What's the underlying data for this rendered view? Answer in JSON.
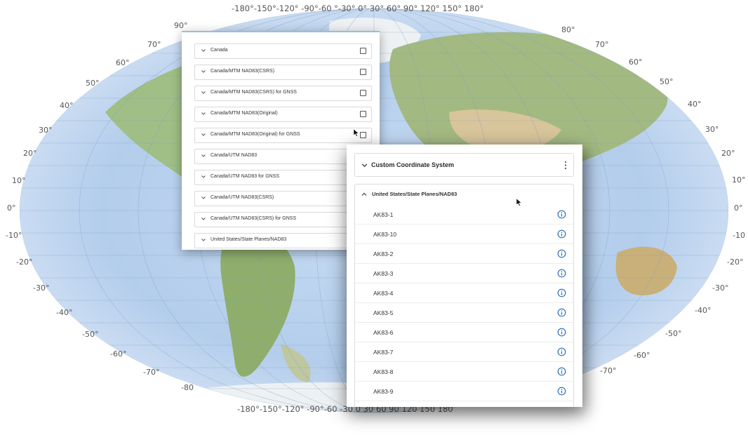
{
  "map": {
    "lat_labels_left": [
      "90°",
      "70°",
      "60°",
      "50°",
      "40°",
      "30°",
      "20°",
      "10°",
      "0°",
      "-10°",
      "-20°",
      "-30°",
      "-40°",
      "-50°",
      "-60°",
      "-70°",
      "-80"
    ],
    "lat_labels_right": [
      "80°",
      "70°",
      "60°",
      "50°",
      "40°",
      "30°",
      "20°",
      "10°",
      "0°",
      "-10",
      "-20°",
      "-30°",
      "-40°",
      "-50°",
      "-60°",
      "-70°"
    ],
    "lon_labels_top": "-180°-150°-120° -90°-60 °-30° 0° 30° 60° 90° 120° 150° 180°",
    "lon_labels_bottom": "-180°-150°-120° -90°-60 -30 0 30 60 90 120 150 180",
    "colors": {
      "ocean": "#b9d3ef",
      "land_green": "#8fb37a",
      "land_tan": "#d9c49a",
      "ice": "#f2f4f6"
    }
  },
  "coordinate_list": {
    "items": [
      {
        "label": "Canada",
        "checkbox": true
      },
      {
        "label": "Canada/MTM NAD83(CSRS)",
        "checkbox": true
      },
      {
        "label": "Canada/MTM NAD83(CSRS) for GNSS",
        "checkbox": true
      },
      {
        "label": "Canada/MTM NAD83(Original)",
        "checkbox": true
      },
      {
        "label": "Canada/MTM NAD83(Original) for GNSS",
        "checkbox": true
      },
      {
        "label": "Canada/UTM NAD83",
        "checkbox": false
      },
      {
        "label": "Canada/UTM NAD83 for GNSS",
        "checkbox": false
      },
      {
        "label": "Canada/UTM NAD83(CSRS)",
        "checkbox": false
      },
      {
        "label": "Canada/UTM NAD83(CSRS) for GNSS",
        "checkbox": false
      },
      {
        "label": "United States/State Planes/NAD83",
        "checkbox": false
      }
    ]
  },
  "custom_panel": {
    "title": "Custom Coordinate System",
    "group_title": "United States/State Planes/NAD83",
    "zones": [
      "AK83-1",
      "AK83-10",
      "AK83-2",
      "AK83-3",
      "AK83-4",
      "AK83-5",
      "AK83-6",
      "AK83-7",
      "AK83-8",
      "AK83-9"
    ]
  }
}
